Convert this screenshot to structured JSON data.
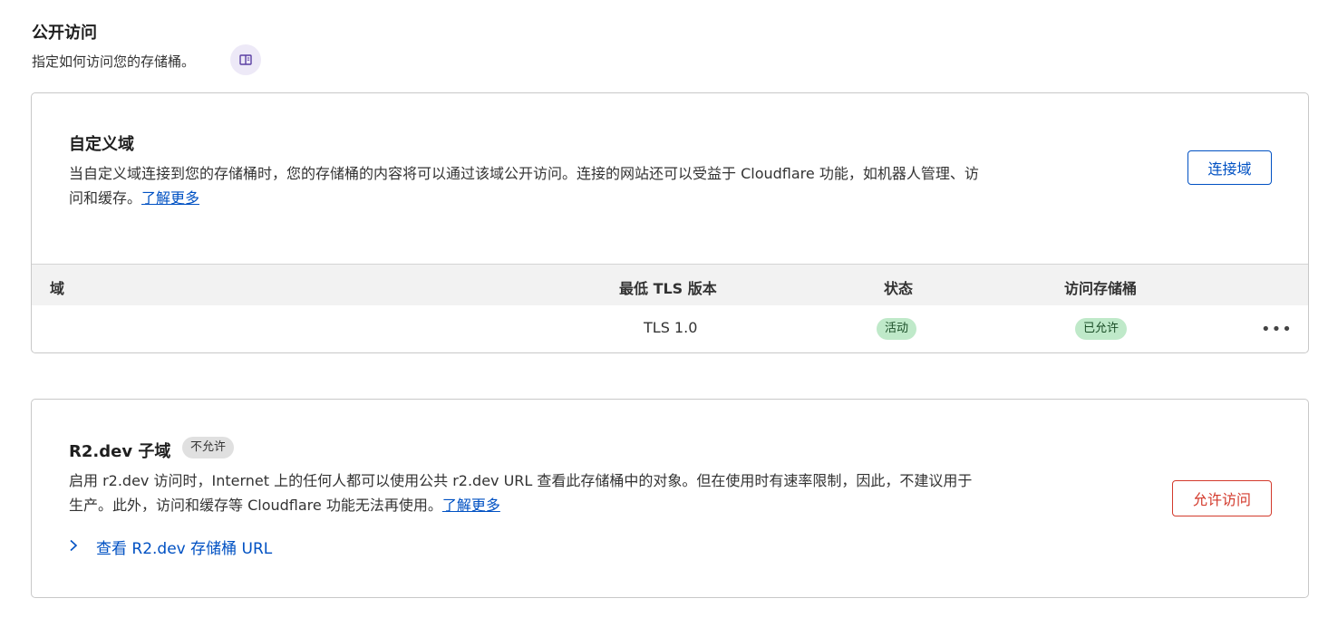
{
  "section": {
    "title": "公开访问",
    "description": "指定如何访问您的存储桶。",
    "doc_icon": "book-icon"
  },
  "custom_domain": {
    "title": "自定义域",
    "description": "当自定义域连接到您的存储桶时，您的存储桶的内容将可以通过该域公开访问。连接的网站还可以受益于 Cloudflare 功能，如机器人管理、访问和缓存。",
    "learn_more": "了解更多",
    "connect_button": "连接域",
    "table": {
      "headers": {
        "domain": "域",
        "min_tls": "最低 TLS 版本",
        "status": "状态",
        "bucket_access": "访问存储桶"
      },
      "rows": [
        {
          "domain": "",
          "min_tls": "TLS 1.0",
          "status": "活动",
          "bucket_access": "已允许",
          "menu_icon": "more-icon"
        }
      ]
    }
  },
  "r2dev": {
    "title": "R2.dev 子域",
    "badge": "不允许",
    "description": "启用 r2.dev 访问时，Internet 上的任何人都可以使用公共 r2.dev URL 查看此存储桶中的对象。但在使用时有速率限制，因此，不建议用于生产。此外，访问和缓存等 Cloudflare 功能无法再使用。",
    "learn_more": "了解更多",
    "allow_button": "允许访问",
    "view_url": "查看 R2.dev 存储桶 URL",
    "expander_icon": "chevron-right-icon"
  },
  "colors": {
    "link": "#0051c3",
    "danger": "#d33a2c",
    "success_bg": "#bfe9c9",
    "header_bg": "#f2f2f2",
    "border": "#c8c8c8"
  }
}
